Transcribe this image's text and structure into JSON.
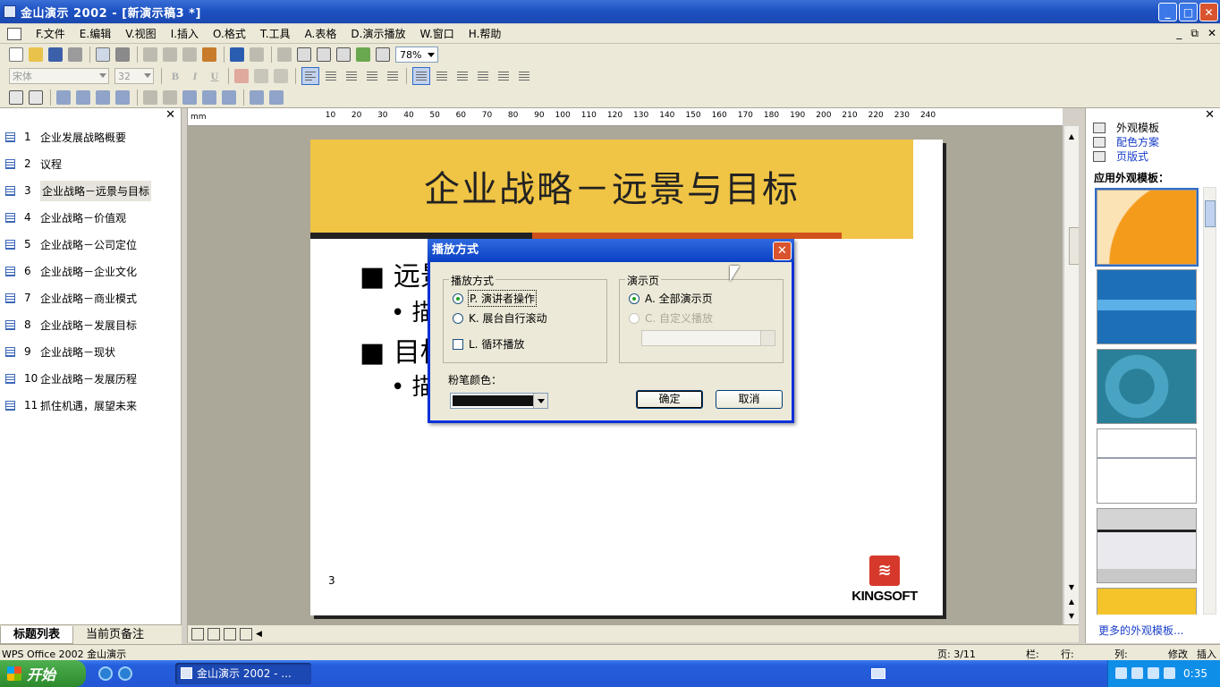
{
  "window": {
    "title": "金山演示 2002 - [新演示稿3 *]",
    "buttons": {
      "minimize": "_",
      "maximize": "□",
      "close": "✕"
    }
  },
  "menu": {
    "items": [
      "F.文件",
      "E.编辑",
      "V.视图",
      "I.插入",
      "O.格式",
      "T.工具",
      "A.表格",
      "D.演示播放",
      "W.窗口",
      "H.帮助"
    ],
    "mdi_buttons": [
      "_",
      "⧉",
      "✕"
    ]
  },
  "toolbar": {
    "zoom": "78%",
    "font_name": "宋体",
    "font_size": "32",
    "bold": "B",
    "italic": "I",
    "underline": "U"
  },
  "outline": {
    "close": "✕",
    "items": [
      {
        "num": "1",
        "title": "企业发展战略概要"
      },
      {
        "num": "2",
        "title": "议程"
      },
      {
        "num": "3",
        "title": "企业战略－远景与目标"
      },
      {
        "num": "4",
        "title": "企业战略－价值观"
      },
      {
        "num": "5",
        "title": "企业战略－公司定位"
      },
      {
        "num": "6",
        "title": "企业战略－企业文化"
      },
      {
        "num": "7",
        "title": "企业战略－商业模式"
      },
      {
        "num": "8",
        "title": "企业战略－发展目标"
      },
      {
        "num": "9",
        "title": "企业战略－现状"
      },
      {
        "num": "10",
        "title": "企业战略－发展历程"
      },
      {
        "num": "11",
        "title": "抓住机遇，展望未来"
      }
    ],
    "selected_index": 2,
    "tabs": [
      "标题列表",
      "当前页备注"
    ]
  },
  "ruler": {
    "unit": "mm",
    "ticks": [
      "10",
      "20",
      "30",
      "40",
      "50",
      "60",
      "70",
      "80",
      "90",
      "100",
      "110",
      "120",
      "130",
      "140",
      "150",
      "160",
      "170",
      "180",
      "190",
      "200",
      "210",
      "220",
      "230",
      "240"
    ]
  },
  "slide": {
    "title": "企业战略－远景与目标",
    "bullet1": "■ 远景",
    "bullet1_sub": "• 描",
    "bullet2": "■ 目标",
    "bullet2_sub": "• 描",
    "page_number": "3",
    "logo_text": "KINGSOFT"
  },
  "dialog": {
    "title": "播放方式",
    "close": "✕",
    "group_mode": {
      "label": "播放方式",
      "opt_presenter": "P. 演讲者操作",
      "opt_kiosk": "K. 展台自行滚动",
      "opt_loop": "L. 循环播放"
    },
    "group_slides": {
      "label": "演示页",
      "opt_all": "A. 全部演示页",
      "opt_custom": "C. 自定义播放"
    },
    "pen_color_label": "粉笔颜色：",
    "pen_color": "#111111",
    "ok": "确定",
    "cancel": "取消"
  },
  "taskpane": {
    "close": "✕",
    "links": [
      "外观模板",
      "配色方案",
      "页版式"
    ],
    "section_title": "应用外观模板：",
    "more_link": "更多的外观模板..."
  },
  "status": {
    "app": "WPS Office 2002 金山演示",
    "page": "页: 3/11",
    "column_label": "栏:",
    "row_label": "行:",
    "col_label": "列:",
    "modify": "修改",
    "insert": "插入"
  },
  "taskbar": {
    "start": "开始",
    "task_item": "金山演示 2002 - ...",
    "clock": "0:35"
  }
}
